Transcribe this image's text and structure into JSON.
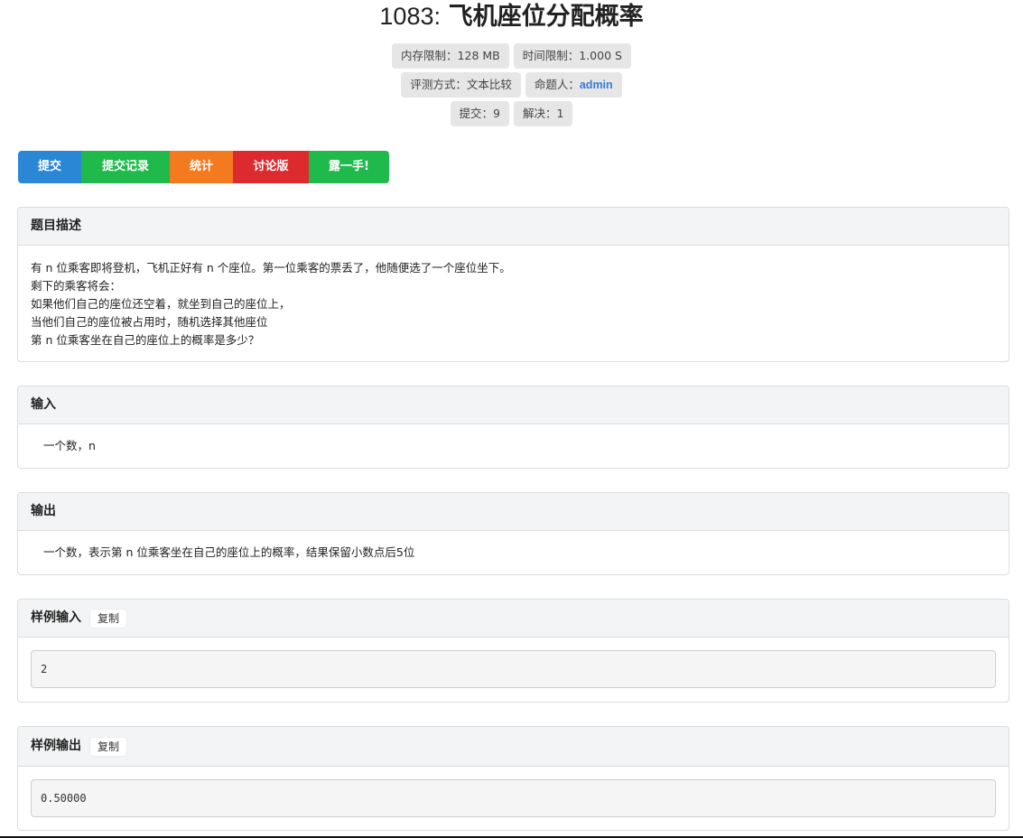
{
  "problem": {
    "id": "1083:",
    "name": "飞机座位分配概率"
  },
  "meta": {
    "memory_limit": "内存限制：128 MB",
    "time_limit": "时间限制：1.000 S",
    "judge_method": "评测方式：文本比较",
    "author_label": "命题人：",
    "author": "admin",
    "submissions": "提交：9",
    "solved": "解决：1"
  },
  "actions": {
    "submit": "提交",
    "records": "提交记录",
    "stats": "统计",
    "discuss": "讨论版",
    "show_hand": "露一手!"
  },
  "colors": {
    "submit": "#2a87d6",
    "records": "#1fba4b",
    "stats": "#f47a1f",
    "discuss": "#dc2a2e",
    "show_hand": "#1fba4b"
  },
  "description": {
    "heading": "题目描述",
    "lines": [
      "有 n 位乘客即将登机，飞机正好有 n 个座位。第一位乘客的票丢了，他随便选了一个座位坐下。",
      "剩下的乘客将会：",
      "如果他们自己的座位还空着，就坐到自己的座位上，",
      "当他们自己的座位被占用时，随机选择其他座位",
      "第 n 位乘客坐在自己的座位上的概率是多少？"
    ]
  },
  "input": {
    "heading": "输入",
    "text": "一个数，n"
  },
  "output": {
    "heading": "输出",
    "text": "一个数，表示第 n 位乘客坐在自己的座位上的概率，结果保留小数点后5位"
  },
  "sample_input": {
    "heading": "样例输入",
    "copy_label": "复制",
    "value": "2"
  },
  "sample_output": {
    "heading": "样例输出",
    "copy_label": "复制",
    "value": "0.50000"
  }
}
